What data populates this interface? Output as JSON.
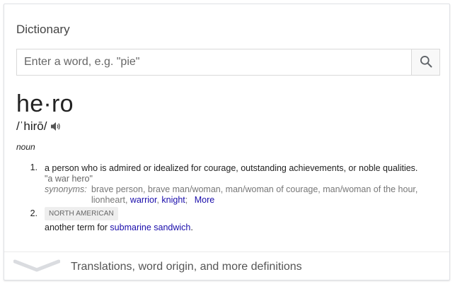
{
  "card": {
    "heading": "Dictionary",
    "search": {
      "placeholder": "Enter a word, e.g. \"pie\"",
      "value": ""
    },
    "search_icon": "search-icon"
  },
  "entry": {
    "word": "he·ro",
    "pronunciation": "/ˈhirō/",
    "speaker_icon": "speaker-icon",
    "part_of_speech": "noun",
    "definitions": [
      {
        "number": "1.",
        "text": "a person who is admired or idealized for courage, outstanding achievements, or noble qualities.",
        "example": "\"a war hero\"",
        "synonyms_label": "synonyms:",
        "synonyms_plain": "brave person, brave man/woman, man/woman of courage, man/woman of the hour, lionheart,",
        "synonym_links": [
          "warrior",
          "knight"
        ],
        "more_label": "More"
      },
      {
        "number": "2.",
        "region": "NORTH AMERICAN",
        "text_prefix": "another term for",
        "link": "submarine sandwich",
        "text_suffix": "."
      }
    ]
  },
  "footer": {
    "label": "Translations, word origin, and more definitions",
    "icon": "chevron-down-icon"
  }
}
